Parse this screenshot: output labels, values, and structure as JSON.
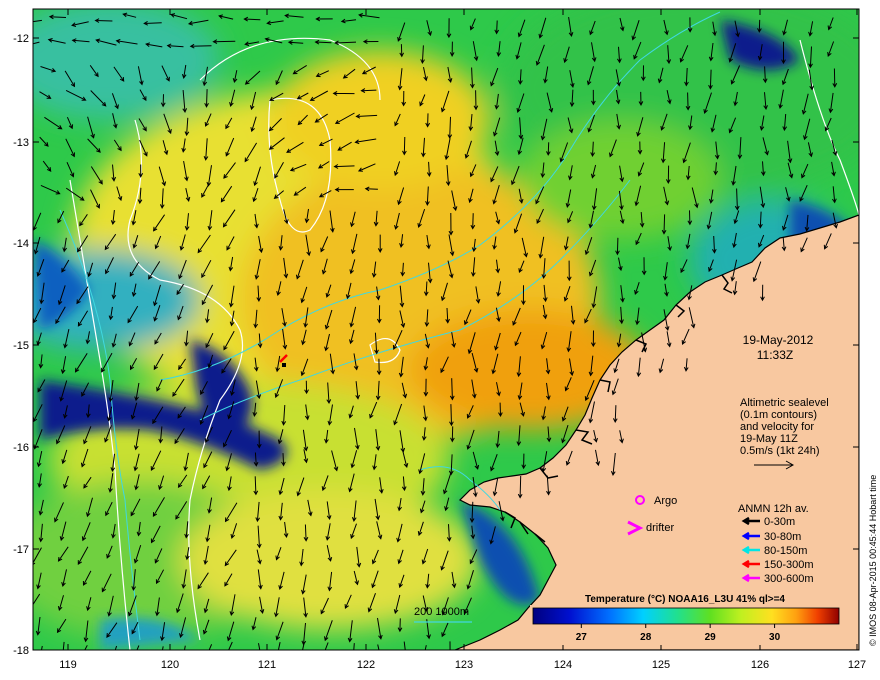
{
  "axes": {
    "lon_ticks": [
      "119",
      "120",
      "121",
      "122",
      "123",
      "124",
      "125",
      "126",
      "127"
    ],
    "lat_ticks": [
      "-12",
      "-13",
      "-14",
      "-15",
      "-16",
      "-17",
      "-18"
    ],
    "lon_range": [
      118.65,
      127.0
    ],
    "lat_range": [
      -18.0,
      -11.7
    ]
  },
  "date": {
    "line1": "19-May-2012",
    "line2": "11:33Z"
  },
  "altimetry_note": [
    "Altimetric sealevel",
    "(0.1m contours)",
    "and velocity for",
    "19-May 11Z",
    "0.5m/s (1kt 24h)"
  ],
  "legend_markers": {
    "argo": "Argo",
    "drifter": "drifter"
  },
  "anmn": {
    "title": "ANMN 12h av.",
    "items": [
      {
        "label": "0-30m",
        "color": "#000000"
      },
      {
        "label": "30-80m",
        "color": "#0000ff"
      },
      {
        "label": "80-150m",
        "color": "#00e5e5"
      },
      {
        "label": "150-300m",
        "color": "#ff0000"
      },
      {
        "label": "300-600m",
        "color": "#ff00ff"
      }
    ]
  },
  "bathymetry_label": "200  1000m",
  "colorbar": {
    "title": "Temperature (°C) NOAA16_L3U 41% ql>=4",
    "ticks": [
      "27",
      "28",
      "29",
      "30"
    ],
    "tick_values": [
      27,
      28,
      29,
      30
    ],
    "range": [
      26.25,
      31.0
    ]
  },
  "credit": "© IMOS 08-Apr-2015 00:45:44 Hobart time",
  "colors": {
    "land": "#f8c8a0",
    "coast": "#000000",
    "sst_cold": "#0a1e8c",
    "sst_warm": "#f0a010"
  }
}
